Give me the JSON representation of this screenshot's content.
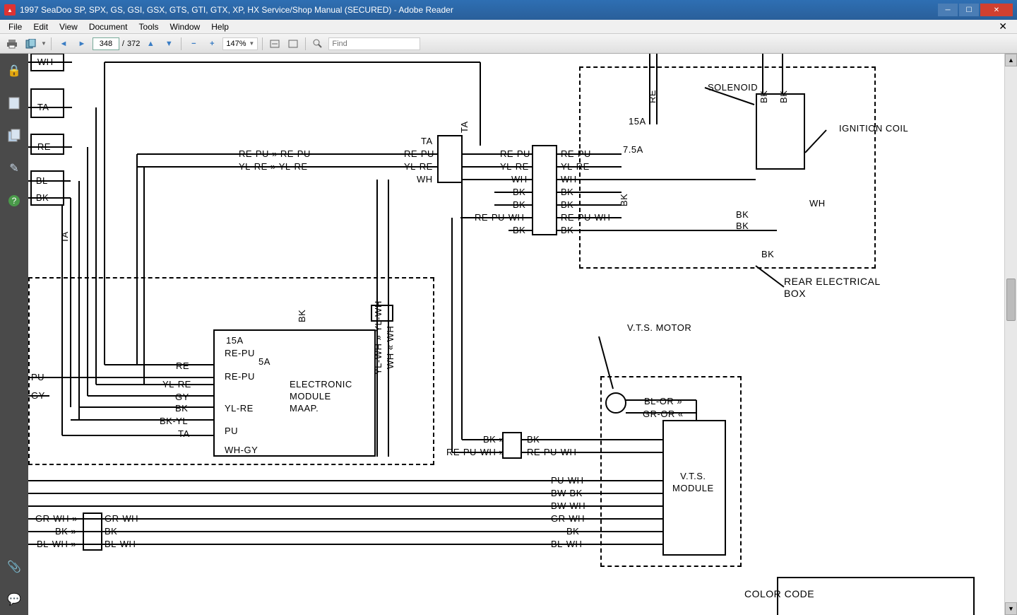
{
  "window": {
    "title": "1997 SeaDoo SP, SPX, GS, GSI, GSX, GTS, GTI, GTX, XP, HX Service/Shop Manual (SECURED) - Adobe Reader"
  },
  "menu": {
    "file": "File",
    "edit": "Edit",
    "view": "View",
    "document": "Document",
    "tools": "Tools",
    "window": "Window",
    "help": "Help"
  },
  "toolbar": {
    "page_current": "348",
    "page_sep": "/",
    "page_total": "372",
    "zoom": "147%",
    "find_placeholder": "Find"
  },
  "icons": {
    "print": "print-icon",
    "save": "save-icon",
    "prev": "prev-page-icon",
    "next": "next-page-icon",
    "up": "page-up-icon",
    "down": "page-down-icon",
    "zoomout": "zoom-out-icon",
    "zoomin": "zoom-in-icon",
    "fitw": "fit-width-icon",
    "fitp": "fit-page-icon",
    "find": "find-icon",
    "lock": "lock-icon",
    "pages": "pages-panel-icon",
    "layers": "layers-icon",
    "sign": "sign-icon",
    "helpq": "help-icon",
    "attach": "attachment-icon",
    "comment": "comment-icon"
  },
  "diagram": {
    "labels": {
      "solenoid": "SOLENOID",
      "ignition_coil": "IGNITION COIL",
      "rear_box": "REAR ELECTRICAL\nBOX",
      "vts_motor": "V.T.S. MOTOR",
      "vts_module": "V.T.S.\nMODULE",
      "color_code": "COLOR CODE",
      "electronic_module": "ELECTRONIC\nMODULE\nMAAP.",
      "fuse15a_top": "15A",
      "fuse7_5a": "7.5A",
      "fuse15a_left": "15A",
      "fuse5a": "5A"
    },
    "wire_colors": {
      "wh": "-WH",
      "ta_neg": "-TA",
      "re_neg": "-RE",
      "bl_neg": "-BL",
      "bk_neg": "-BK",
      "pu": "PU",
      "gy": "GY",
      "ta": "TA",
      "re_pu": "RE-PU",
      "yl_re": "YL-RE",
      "wh_plain": "WH",
      "bk": "BK",
      "re_pu_wh": "RE-PU-WH",
      "re": "RE",
      "yl_re2": "YL-RE",
      "gy2": "GY",
      "bk2": "BK",
      "bk_yl": "BK-YL",
      "ta2": "TA",
      "wh_gy": "WH-GY",
      "yl_wh": "YL-WH",
      "bl_or": "BL-OR",
      "gr_or": "GR-OR",
      "pu_wh": "PU-WH",
      "bw_bk": "BW-BK",
      "bw_wh": "BW-WH",
      "gr_wh": "GR-WH",
      "bl_wh": "BL-WH"
    }
  }
}
